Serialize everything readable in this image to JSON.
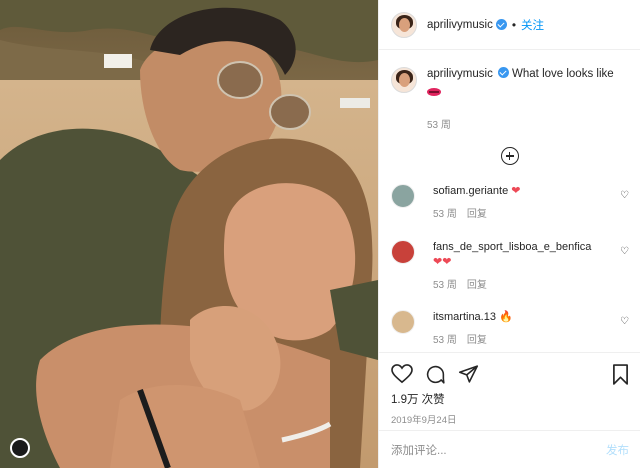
{
  "post": {
    "username": "aprilivymusic",
    "follow_label": "关注",
    "separator": "•",
    "more_label": "···"
  },
  "caption": {
    "username": "aprilivymusic",
    "text": "What love looks like",
    "emoji_icon": "lips-icon",
    "age": "53 周"
  },
  "comments": [
    {
      "username": "sofiam.geriante",
      "hearts": "❤",
      "age": "53 周",
      "reply": "回复",
      "avatar_color": "#8aa4a0"
    },
    {
      "username": "fans_de_sport_lisboa_e_benfica",
      "hearts": "❤❤",
      "age": "53 周",
      "reply": "回复",
      "avatar_color": "#c8413a"
    },
    {
      "username": "itsmartina.13",
      "hearts": "🔥",
      "age": "53 周",
      "reply": "回复",
      "avatar_color": "#d8b88e"
    }
  ],
  "actions": {
    "like_icon": "heart-icon",
    "comment_icon": "comment-icon",
    "share_icon": "paper-plane-icon",
    "save_icon": "bookmark-icon",
    "likes": "1.9万 次赞",
    "date": "2019年9月24日"
  },
  "add_comment": {
    "placeholder": "添加评论...",
    "post_label": "发布"
  },
  "colors": {
    "accent": "#0095f6",
    "verified": "#3897f0",
    "heart": "#ed4956",
    "muted": "#8e8e8e"
  }
}
